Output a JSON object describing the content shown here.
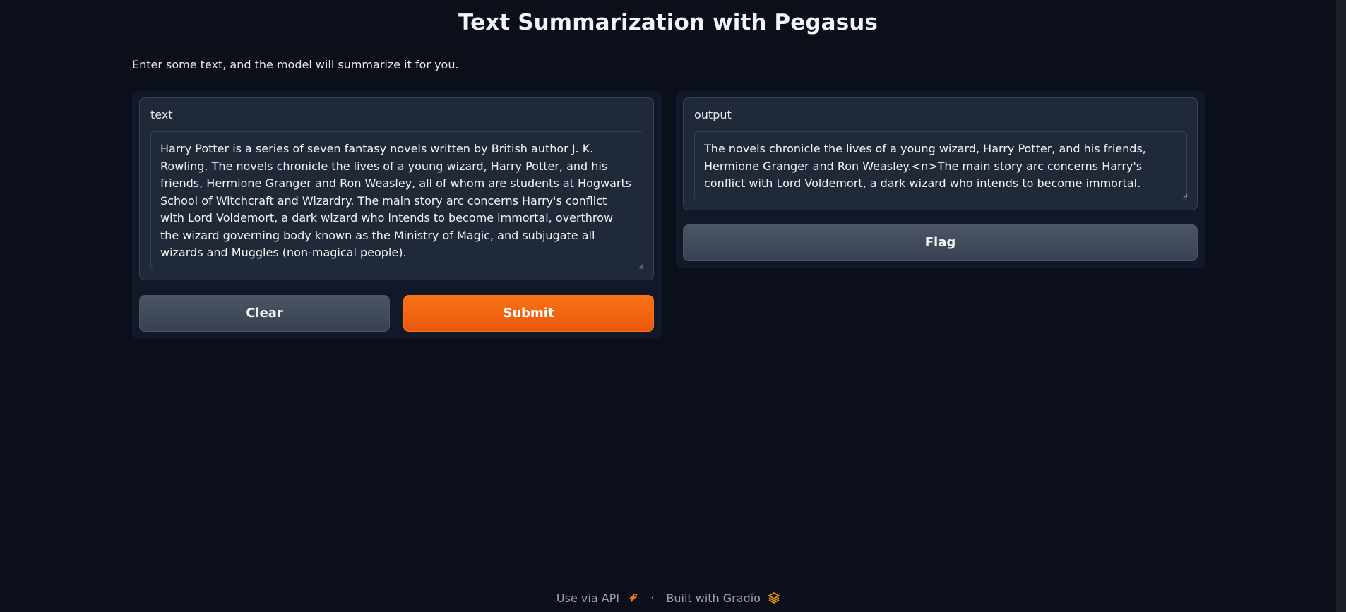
{
  "header": {
    "title": "Text Summarization with Pegasus",
    "description": "Enter some text, and the model will summarize it for you."
  },
  "input": {
    "label": "text",
    "value": "Harry Potter is a series of seven fantasy novels written by British author J. K. Rowling. The novels chronicle the lives of a young wizard, Harry Potter, and his friends, Hermione Granger and Ron Weasley, all of whom are students at Hogwarts School of Witchcraft and Wizardry. The main story arc concerns Harry's conflict with Lord Voldemort, a dark wizard who intends to become immortal, overthrow the wizard governing body known as the Ministry of Magic, and subjugate all wizards and Muggles (non-magical people)."
  },
  "output": {
    "label": "output",
    "value": "The novels chronicle the lives of a young wizard, Harry Potter, and his friends, Hermione Granger and Ron Weasley.<n>The main story arc concerns Harry's conflict with Lord Voldemort, a dark wizard who intends to become immortal."
  },
  "buttons": {
    "clear": "Clear",
    "submit": "Submit",
    "flag": "Flag"
  },
  "footer": {
    "api_link": "Use via API",
    "separator": "·",
    "built_with": "Built with Gradio"
  },
  "icons": {
    "api": "rocket-icon",
    "gradio": "gradio-logo-icon"
  },
  "colors": {
    "background": "#0b0f19",
    "panel": "#111827",
    "block": "#1f2937",
    "primary": "#f97316",
    "secondary": "#4b5563"
  }
}
